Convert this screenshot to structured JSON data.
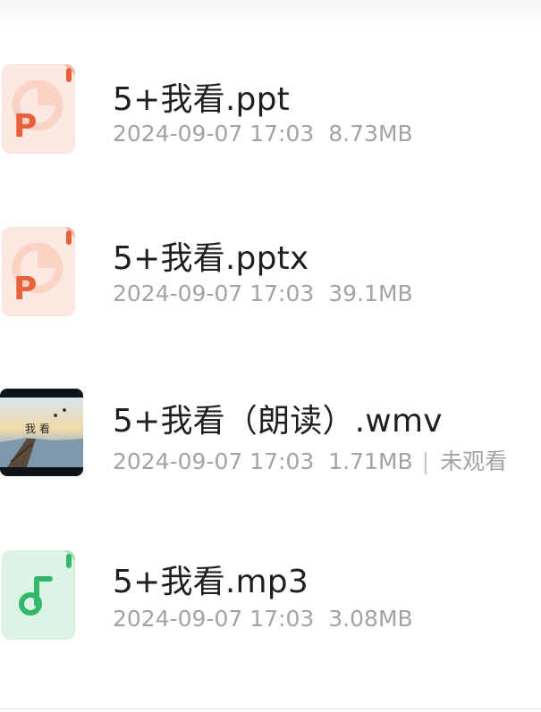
{
  "colors": {
    "ppt_accent": "#e8603c",
    "ppt_bg": "#fde6de",
    "audio_accent": "#33b86b",
    "audio_bg": "#dcf3e5",
    "name_text": "#1f1f1f",
    "meta_text": "#a3a3a3"
  },
  "files": [
    {
      "name": "5+我看.ppt",
      "date": "2024-09-07 17:03",
      "size": "8.73MB",
      "icon": "ppt-file-icon",
      "icon_letter": "P",
      "status": ""
    },
    {
      "name": "5+我看.pptx",
      "date": "2024-09-07 17:03",
      "size": "39.1MB",
      "icon": "pptx-file-icon",
      "icon_letter": "P",
      "status": ""
    },
    {
      "name": "5+我看（朗读）.wmv",
      "date": "2024-09-07 17:03",
      "size": "1.71MB",
      "icon": "video-thumbnail",
      "status": "未观看",
      "thumb_text": "我 看"
    },
    {
      "name": "5+我看.mp3",
      "date": "2024-09-07 17:03",
      "size": "3.08MB",
      "icon": "music-note-icon",
      "status": ""
    }
  ]
}
